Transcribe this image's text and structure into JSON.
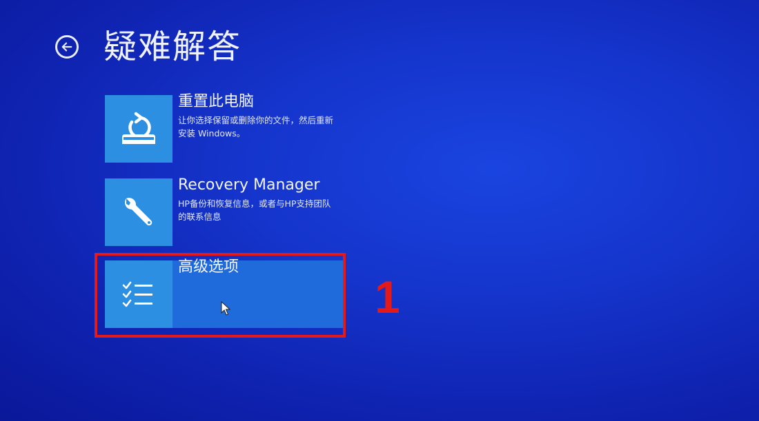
{
  "header": {
    "title": "疑难解答",
    "back_icon": "back-arrow-icon"
  },
  "options": [
    {
      "id": "reset",
      "icon": "reset-pc-icon",
      "title": "重置此电脑",
      "description": "让你选择保留或删除你的文件，然后重新安装 Windows。"
    },
    {
      "id": "recovery",
      "icon": "wrench-icon",
      "title": "Recovery Manager",
      "description": "HP备份和恢复信息，或者与HP支持团队的联系信息"
    },
    {
      "id": "advanced",
      "icon": "checklist-icon",
      "title": "高级选项",
      "description": ""
    }
  ],
  "annotation": {
    "step_number": "1",
    "color": "#e41a1a"
  },
  "colors": {
    "background": "#1535cc",
    "tile": "#2d8fe2",
    "selected": "#1f6bdc"
  }
}
